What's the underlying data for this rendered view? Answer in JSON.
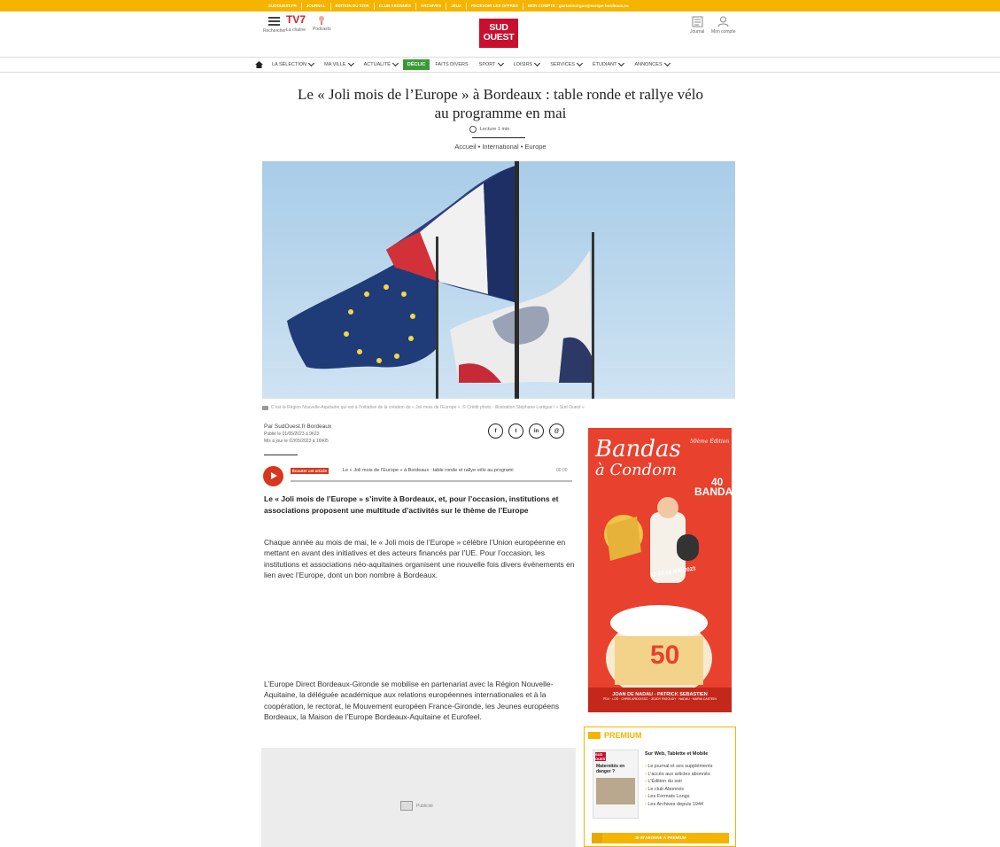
{
  "topbar": {
    "links": [
      "SUDOUEST.FR",
      "JOURNAL",
      "ÉDITION DU SOIR",
      "CLUB ABONNÉS",
      "ARCHIVES",
      "JEUX",
      "RECEVOIR LES OFFRES",
      "MON COMPTE : gaetanmorgan@europe-bordeaux.eu"
    ]
  },
  "header": {
    "search_label": "Rechercher",
    "tv7_label": "TV7",
    "channel_label": "La chaîne",
    "podcasts_label": "Podcasts",
    "logo_line1": "SUD",
    "logo_line2": "OUEST",
    "journal_label": "Journal",
    "account_label": "Mon compte"
  },
  "nav": {
    "items": [
      "LA SÉLECTION",
      "MA VILLE",
      "ACTUALITÉ",
      "DÉCLIC",
      "FAITS DIVERS",
      "SPORT",
      "LOISIRS",
      "SERVICES",
      "ÉTUDIANT",
      "ANNONCES"
    ]
  },
  "article": {
    "title": "Le « Joli mois de l’Europe » à Bordeaux : table ronde et rallye vélo au programme en mai",
    "reading_time": "Lecture 1 min",
    "breadcrumb": "Accueil • International • Europe",
    "caption": "C’est la Région Nouvelle-Aquitaine qui est à l’initiative de la création du « Joli mois de l’Europe ». © Crédit photo : illustration Stéphane Lartigue / « Sud Ouest »",
    "author": "Par SudOuest.fr Bordeaux",
    "published": "Publié le 01/05/2023 à 9h23",
    "updated": "Mis à jour le 02/05/2023 à 16h05",
    "share": [
      "f",
      "t",
      "in",
      "@"
    ],
    "listen_label": "Écouter cet article",
    "player_title": "Le « Joli mois de l’Europe » à Bordeaux : table ronde et rallye vélo au programi",
    "player_time": "00:00",
    "lead": "Le « Joli mois de l’Europe » s’invite à Bordeaux, et, pour l’occasion, institutions et associations proposent une multitude d’activités sur le thème de l’Europe",
    "para1": "Chaque année au mois de mai, le « Joli mois de l’Europe » célèbre l’Union européenne en mettant en avant des initiatives et des acteurs financés par l’UE. Pour l’occasion, les institutions et associations néo-aquitaines organisent une nouvelle fois divers événements en lien avec l’Europe, dont un bon nombre à Bordeaux.",
    "para2": "L’Europe Direct Bordeaux-Gironde se mobilise en partenariat avec la Région Nouvelle-Aquitaine, la déléguée académique aux relations européennes internationales et à la coopération, le rectorat, le Mouvement européen France-Gironde, les Jeunes européens Bordeaux, la Maison de l’Europe Bordeaux-Aquitaine et Eurofeel.",
    "ad_label": "Publicité"
  },
  "side_ad": {
    "title": "Bandas",
    "subtitle": "à Condom",
    "edition": "50ème Édition",
    "forty_line1": "40",
    "forty_line2": "BANDAS",
    "dates": "12-13-14 MAI 2023",
    "fifty": "50",
    "footer": "JOAN DE NADAU - PATRICK SEBASTIEN",
    "footer_small": "PDX · LOS · CHRIS ARDOISSO · JEUDY RIGOUDY · NADAU · MARIA CASTEIN"
  },
  "premium": {
    "title": "PREMIUM",
    "list_title": "Sur Web, Tablette et Mobile",
    "items": [
      "Le journal et ses suppléments",
      "L’accès aux articles abonnés",
      "L’Édition du soir",
      "Le club Abonnés",
      "Les Formats Longs",
      "Les Archives depuis 1944"
    ],
    "button": "JE M’ABONNE À PREMIUM",
    "paper_masthead": "SUD OUEST",
    "paper_headline": "Maternités en danger ?"
  }
}
